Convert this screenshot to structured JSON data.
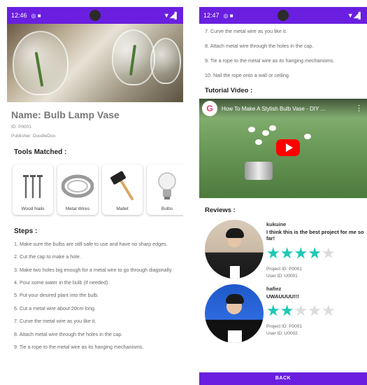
{
  "left_screen": {
    "status": {
      "time": "12:46",
      "icons": "◎ ■",
      "right": "▼◢▌"
    },
    "product": {
      "name": "Name: Bulb Lamp Vase",
      "id": "ID: P0001",
      "publisher": "Publisher: DoodleDoo"
    },
    "tools_title": "Tools Matched :",
    "tools": [
      {
        "name": "Wood Nails",
        "icon": "nails-icon"
      },
      {
        "name": "Metal Wires",
        "icon": "wire-coil-icon"
      },
      {
        "name": "Mallet",
        "icon": "mallet-icon"
      },
      {
        "name": "Bulbs",
        "icon": "bulb-icon"
      }
    ],
    "steps_title": "Steps :",
    "steps": [
      "1. Make sure the bulbs are still safe to use and have no sharp edges.",
      "2. Cut the cap to make a hole.",
      "3. Make two holes big enough for a metal wire to go through diagonally.",
      "4. Pour some water in the bulb (If needed).",
      "5. Put your desired plant into the bulb.",
      "6. Cut a metal wire about 20cm long.",
      "7. Curve the metal wire as you like it.",
      "8. Attach metal wire through the holes in the cap.",
      "9. Tie a rope to the metal wire as its hanging mechanisms."
    ]
  },
  "right_screen": {
    "status": {
      "time": "12:47",
      "icons": "◎ ■",
      "right": "▼◢▌"
    },
    "steps": [
      "7. Curve the metal wire as you like it.",
      "8. Attach metal wire through the holes in the cap.",
      "9. Tie a rope to the metal wire as its hanging mechanisms.",
      "10. Nail the rope onto a wall or ceiling."
    ],
    "tutorial_title": "Tutorial Video :",
    "video": {
      "title": "How To Make A Stylish Bulb Vase - DIY ...",
      "logo_letter": "G",
      "menu": "⋮"
    },
    "reviews_title": "Reviews :",
    "reviews": [
      {
        "user": "kukuine",
        "text": "I think this is the best project for me so far!",
        "rating": 4,
        "project_id": "Project ID: P0001",
        "user_id": "User ID: U0001"
      },
      {
        "user": "hafiez",
        "text": "UWAUUUU!!!",
        "rating": 2,
        "project_id": "Project ID: P0001",
        "user_id": "User ID: U0002"
      }
    ],
    "back_label": "BACK"
  },
  "colors": {
    "accent": "#6a1fe0",
    "star": "#1cc9b5",
    "star_off": "#dcdcdc"
  }
}
